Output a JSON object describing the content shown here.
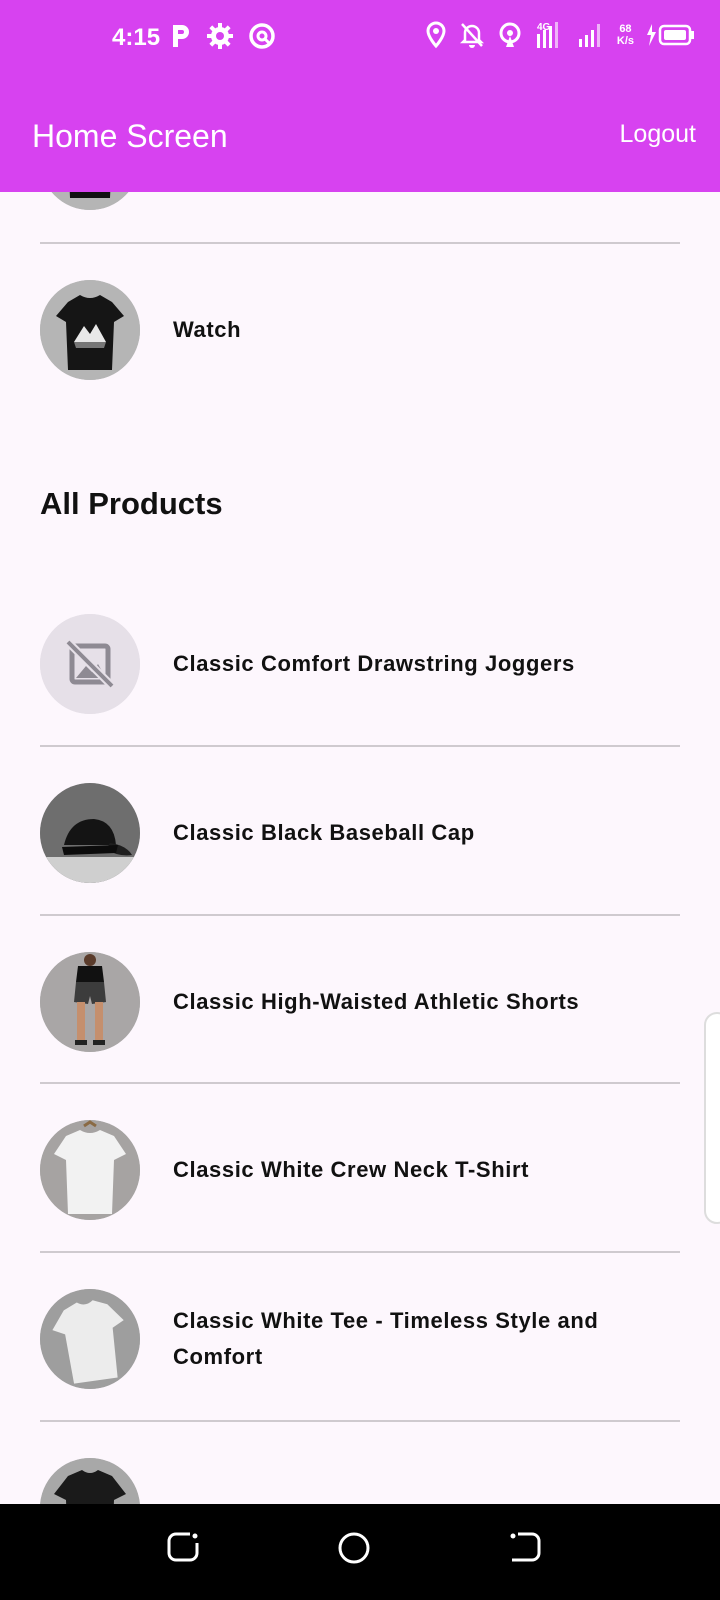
{
  "status_bar": {
    "time": "4:15",
    "net_speed_value": "68",
    "net_speed_unit": "K/s",
    "network_type": "4G"
  },
  "app_bar": {
    "title": "Home Screen",
    "logout_label": "Logout"
  },
  "categories": {
    "items": [
      {
        "label": "",
        "icon": "tshirt-thumbnail"
      },
      {
        "label": "Watch",
        "icon": "tshirt-thumbnail"
      }
    ]
  },
  "all_products": {
    "title": "All Products",
    "items": [
      {
        "label": "Classic Comfort Drawstring Joggers",
        "icon": "image-not-supported-icon"
      },
      {
        "label": "Classic Black Baseball Cap",
        "icon": "baseball-cap-thumbnail"
      },
      {
        "label": "Classic High-Waisted Athletic Shorts",
        "icon": "athletic-shorts-thumbnail"
      },
      {
        "label": "Classic White Crew Neck T-Shirt",
        "icon": "white-tshirt-thumbnail"
      },
      {
        "label": "Classic White Tee - Timeless Style and Comfort",
        "icon": "white-tee-thumbnail"
      }
    ]
  },
  "colors": {
    "accent": "#d742f0",
    "background": "#fdf7fd",
    "divider": "#cfcacf"
  }
}
